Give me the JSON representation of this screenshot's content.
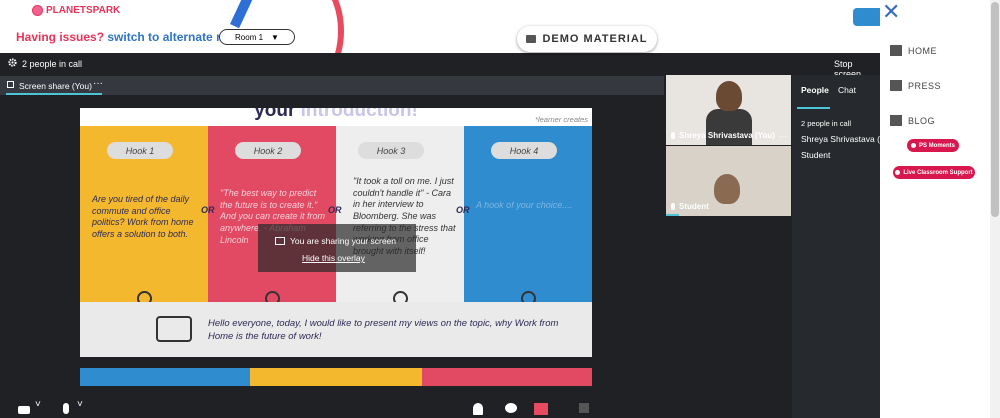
{
  "logo": {
    "text": "PLANETSPARK"
  },
  "issues": {
    "prefix": "Having issues?",
    "link": "switch to alternate room"
  },
  "room_select": {
    "value": "Room 1",
    "arrow": "▼"
  },
  "demo_button": {
    "label": "DEMO MATERIAL",
    "icon": "folder-icon"
  },
  "call": {
    "people_count": "2 people in call",
    "stop_label": "Stop screen",
    "share_tab_label": "Screen share (You)",
    "share_tab_more": "···"
  },
  "slide": {
    "title_a": "your ",
    "title_b": "introduction!",
    "learner_note": "*learner creates",
    "hooks": [
      {
        "label": "Hook 1",
        "text": "Are you tired of the daily commute and office politics? Work from home offers a solution to both."
      },
      {
        "label": "Hook 2",
        "text": "\"The best way to predict the future is to create it.\" And you can create it from anywhere. - Abraham Lincoln"
      },
      {
        "label": "Hook 3",
        "text": "\"It took a toll on me. I just couldn't handle it\" - Cara in her interview to Bloomberg. She was referring to the stress that working from office brought with itself!"
      },
      {
        "label": "Hook 4",
        "text": "A hook of your choice...."
      }
    ],
    "or_label": "OR",
    "intro": "Hello everyone, today, I would like to present my views on the topic, why Work from Home is the future of work!"
  },
  "overlay": {
    "message": "You are sharing your screen",
    "hide_link": "Hide this overlay"
  },
  "videos": [
    {
      "name": "Shreya Shrivastava (You)",
      "more": "···"
    },
    {
      "name": "Student"
    }
  ],
  "side_panel": {
    "tab_people": "People",
    "tab_chat": "Chat",
    "count": "2 people in call",
    "participants": [
      "Shreya Shrivastava (You)",
      "Student"
    ]
  },
  "toolbar": {
    "cam_chevron": "˅",
    "mic_chevron": "˅"
  },
  "menu": {
    "close": "✕",
    "items": [
      "HOME",
      "PRESS",
      "BLOG"
    ],
    "ps_moments": "PS Moments",
    "live_support": "Live Classroom Support"
  },
  "colors": {
    "brand_red": "#e8335a",
    "link_blue": "#2e74c8",
    "accent_teal": "#4ec3d3",
    "call_bg": "#1f2124"
  }
}
